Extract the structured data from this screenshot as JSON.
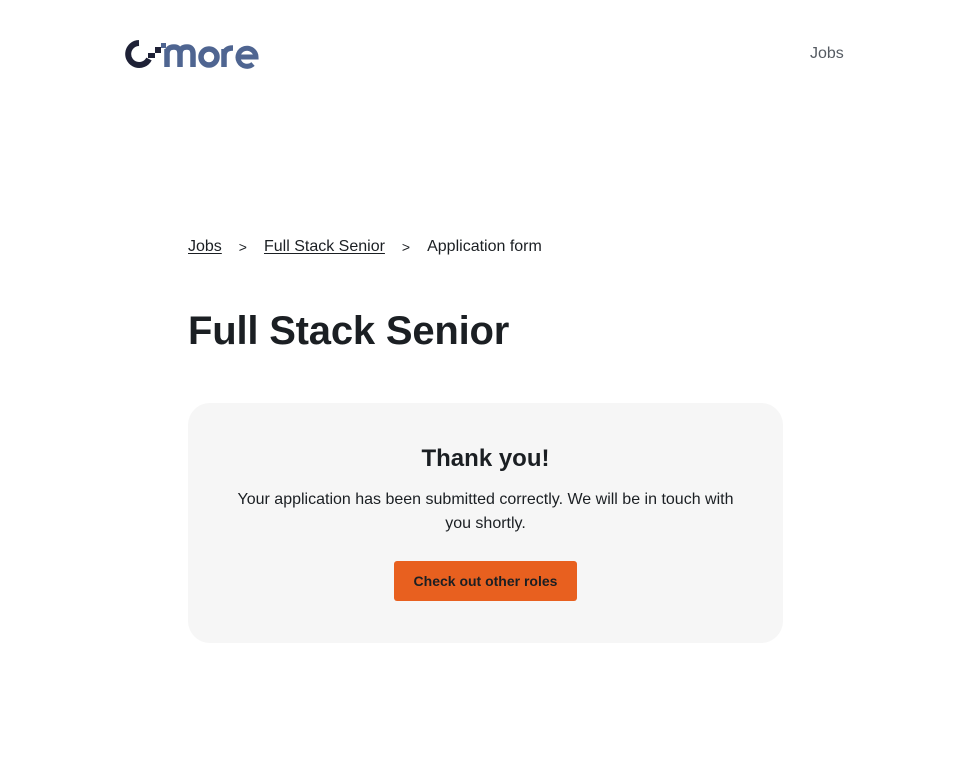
{
  "header": {
    "logo_text": "c-more",
    "nav": {
      "jobs_label": "Jobs"
    }
  },
  "breadcrumb": {
    "items": [
      {
        "label": "Jobs"
      },
      {
        "label": "Full Stack Senior"
      },
      {
        "label": "Application form"
      }
    ],
    "separator": ">"
  },
  "page": {
    "title": "Full Stack Senior"
  },
  "confirmation": {
    "title": "Thank you!",
    "message": "Your application has been submitted correctly. We will be in touch with you shortly.",
    "button_label": "Check out other roles"
  },
  "colors": {
    "accent": "#e8601f",
    "logo_dark": "#1e2136",
    "logo_blue": "#4f6591",
    "card_bg": "#f6f6f6",
    "text": "#1b1f23"
  }
}
